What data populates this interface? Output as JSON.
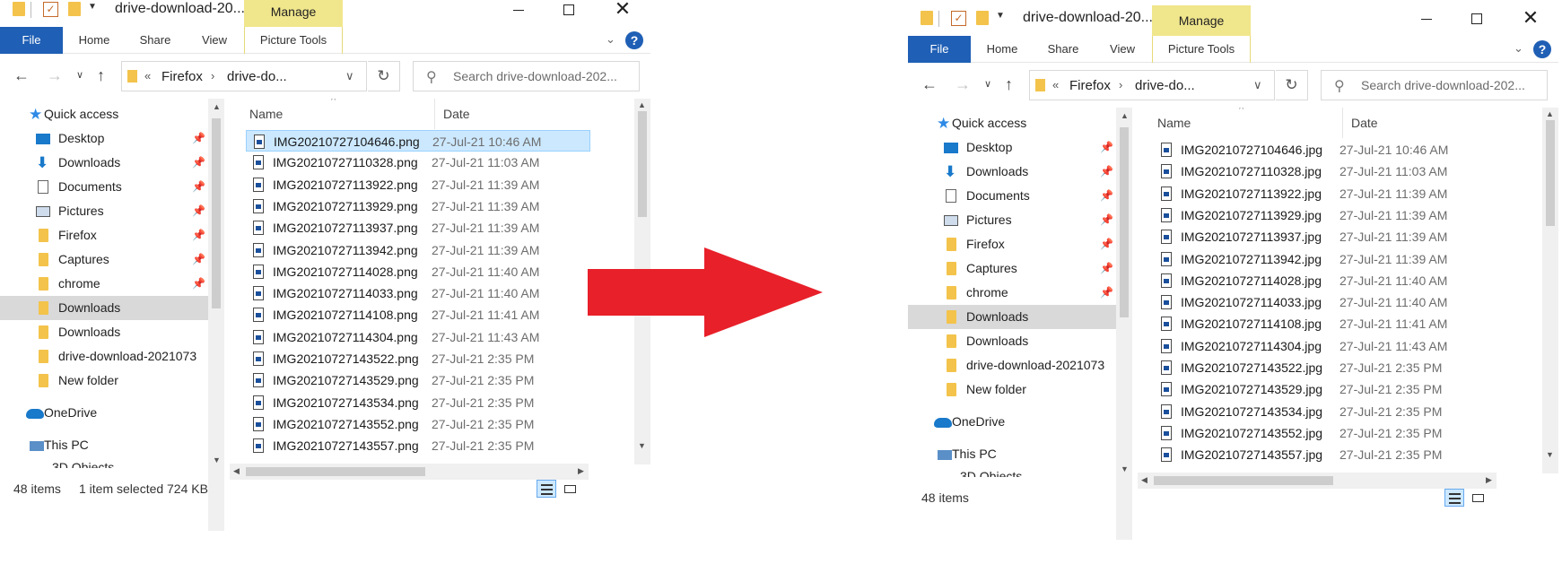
{
  "arrow_color": "#e8202a",
  "windows": [
    {
      "title": "drive-download-20...",
      "manage_label": "Manage",
      "ribbon": {
        "file": "File",
        "home": "Home",
        "share": "Share",
        "view": "View",
        "picture_tools": "Picture Tools"
      },
      "address": {
        "crumb_chevron": "«",
        "part1": "Firefox",
        "part2": "drive-do..."
      },
      "search_placeholder": "Search drive-download-202...",
      "nav": {
        "quick_access": "Quick access",
        "items": [
          {
            "label": "Desktop",
            "pinned": true
          },
          {
            "label": "Downloads",
            "pinned": true
          },
          {
            "label": "Documents",
            "pinned": true
          },
          {
            "label": "Pictures",
            "pinned": true
          },
          {
            "label": "Firefox",
            "pinned": true
          },
          {
            "label": "Captures",
            "pinned": true
          },
          {
            "label": "chrome",
            "pinned": true
          },
          {
            "label": "Downloads",
            "pinned": false,
            "selected": true
          },
          {
            "label": "Downloads",
            "pinned": false
          },
          {
            "label": "drive-download-2021073",
            "pinned": false
          },
          {
            "label": "New folder",
            "pinned": false
          }
        ],
        "onedrive": "OneDrive",
        "this_pc": "This PC",
        "objects_3d": "3D Objects"
      },
      "columns": {
        "name": "Name",
        "date": "Date"
      },
      "files": [
        {
          "name": "IMG20210727104646.png",
          "date": "27-Jul-21 10:46 AM",
          "selected": true
        },
        {
          "name": "IMG20210727110328.png",
          "date": "27-Jul-21 11:03 AM"
        },
        {
          "name": "IMG20210727113922.png",
          "date": "27-Jul-21 11:39 AM"
        },
        {
          "name": "IMG20210727113929.png",
          "date": "27-Jul-21 11:39 AM"
        },
        {
          "name": "IMG20210727113937.png",
          "date": "27-Jul-21 11:39 AM"
        },
        {
          "name": "IMG20210727113942.png",
          "date": "27-Jul-21 11:39 AM"
        },
        {
          "name": "IMG20210727114028.png",
          "date": "27-Jul-21 11:40 AM"
        },
        {
          "name": "IMG20210727114033.png",
          "date": "27-Jul-21 11:40 AM"
        },
        {
          "name": "IMG20210727114108.png",
          "date": "27-Jul-21 11:41 AM"
        },
        {
          "name": "IMG20210727114304.png",
          "date": "27-Jul-21 11:43 AM"
        },
        {
          "name": "IMG20210727143522.png",
          "date": "27-Jul-21 2:35 PM"
        },
        {
          "name": "IMG20210727143529.png",
          "date": "27-Jul-21 2:35 PM"
        },
        {
          "name": "IMG20210727143534.png",
          "date": "27-Jul-21 2:35 PM"
        },
        {
          "name": "IMG20210727143552.png",
          "date": "27-Jul-21 2:35 PM"
        },
        {
          "name": "IMG20210727143557.png",
          "date": "27-Jul-21 2:35 PM"
        }
      ],
      "status": {
        "count": "48 items",
        "selected": "1 item selected",
        "size": "724 KB"
      }
    },
    {
      "title": "drive-download-20...",
      "manage_label": "Manage",
      "ribbon": {
        "file": "File",
        "home": "Home",
        "share": "Share",
        "view": "View",
        "picture_tools": "Picture Tools"
      },
      "address": {
        "crumb_chevron": "«",
        "part1": "Firefox",
        "part2": "drive-do..."
      },
      "search_placeholder": "Search drive-download-202...",
      "nav": {
        "quick_access": "Quick access",
        "items": [
          {
            "label": "Desktop",
            "pinned": true
          },
          {
            "label": "Downloads",
            "pinned": true
          },
          {
            "label": "Documents",
            "pinned": true
          },
          {
            "label": "Pictures",
            "pinned": true
          },
          {
            "label": "Firefox",
            "pinned": true
          },
          {
            "label": "Captures",
            "pinned": true
          },
          {
            "label": "chrome",
            "pinned": true
          },
          {
            "label": "Downloads",
            "pinned": false,
            "selected": true
          },
          {
            "label": "Downloads",
            "pinned": false
          },
          {
            "label": "drive-download-2021073",
            "pinned": false
          },
          {
            "label": "New folder",
            "pinned": false
          }
        ],
        "onedrive": "OneDrive",
        "this_pc": "This PC",
        "objects_3d": "3D Objects"
      },
      "columns": {
        "name": "Name",
        "date": "Date"
      },
      "files": [
        {
          "name": "IMG20210727104646.jpg",
          "date": "27-Jul-21 10:46 AM"
        },
        {
          "name": "IMG20210727110328.jpg",
          "date": "27-Jul-21 11:03 AM"
        },
        {
          "name": "IMG20210727113922.jpg",
          "date": "27-Jul-21 11:39 AM"
        },
        {
          "name": "IMG20210727113929.jpg",
          "date": "27-Jul-21 11:39 AM"
        },
        {
          "name": "IMG20210727113937.jpg",
          "date": "27-Jul-21 11:39 AM"
        },
        {
          "name": "IMG20210727113942.jpg",
          "date": "27-Jul-21 11:39 AM"
        },
        {
          "name": "IMG20210727114028.jpg",
          "date": "27-Jul-21 11:40 AM"
        },
        {
          "name": "IMG20210727114033.jpg",
          "date": "27-Jul-21 11:40 AM"
        },
        {
          "name": "IMG20210727114108.jpg",
          "date": "27-Jul-21 11:41 AM"
        },
        {
          "name": "IMG20210727114304.jpg",
          "date": "27-Jul-21 11:43 AM"
        },
        {
          "name": "IMG20210727143522.jpg",
          "date": "27-Jul-21 2:35 PM"
        },
        {
          "name": "IMG20210727143529.jpg",
          "date": "27-Jul-21 2:35 PM"
        },
        {
          "name": "IMG20210727143534.jpg",
          "date": "27-Jul-21 2:35 PM"
        },
        {
          "name": "IMG20210727143552.jpg",
          "date": "27-Jul-21 2:35 PM"
        },
        {
          "name": "IMG20210727143557.jpg",
          "date": "27-Jul-21 2:35 PM"
        }
      ],
      "status": {
        "count": "48 items",
        "selected": "",
        "size": ""
      }
    }
  ]
}
